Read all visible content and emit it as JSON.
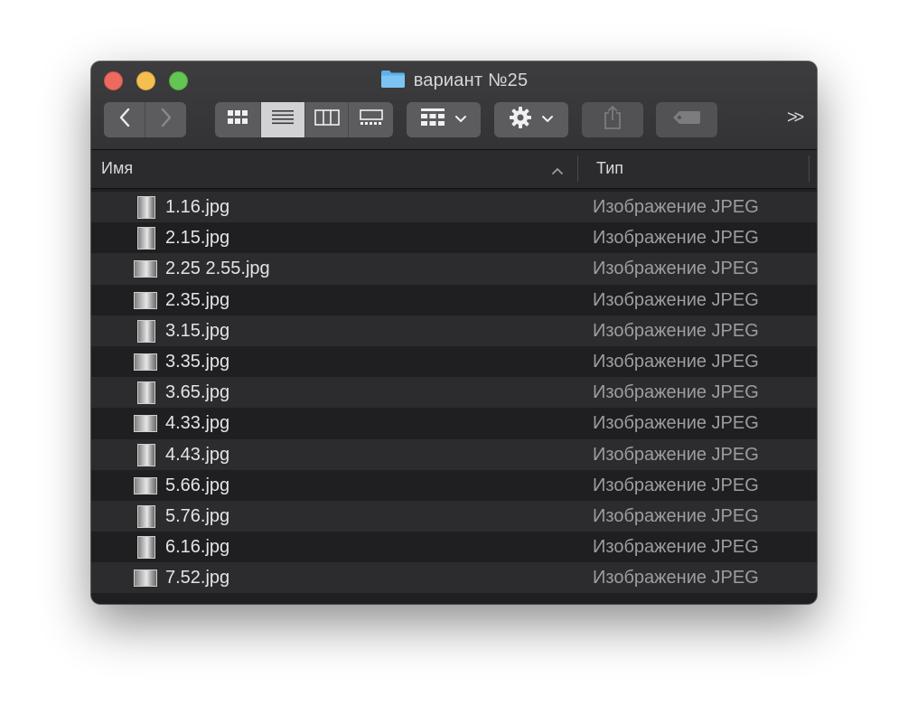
{
  "window": {
    "title": "вариант №25",
    "title_icon": "folder-icon"
  },
  "toolbar": {
    "back_icon": "chevron-left-icon",
    "forward_icon": "chevron-right-icon",
    "view_modes": [
      {
        "name": "icon-view",
        "icon": "grid-icon",
        "active": false
      },
      {
        "name": "list-view",
        "icon": "list-icon",
        "active": true
      },
      {
        "name": "column-view",
        "icon": "columns-icon",
        "active": false
      },
      {
        "name": "gallery-view",
        "icon": "gallery-icon",
        "active": false
      }
    ],
    "group_icon": "group-by-icon",
    "action_icon": "gear-icon",
    "share_icon": "share-icon",
    "tags_icon": "tag-icon",
    "overflow_label": ">>"
  },
  "list": {
    "columns": {
      "name": "Имя",
      "type": "Тип"
    },
    "rows": [
      {
        "name": "1.16.jpg",
        "type": "Изображение JPEG",
        "orientation": "portrait"
      },
      {
        "name": "2.15.jpg",
        "type": "Изображение JPEG",
        "orientation": "portrait"
      },
      {
        "name": "2.25 2.55.jpg",
        "type": "Изображение JPEG",
        "orientation": "landscape"
      },
      {
        "name": "2.35.jpg",
        "type": "Изображение JPEG",
        "orientation": "landscape"
      },
      {
        "name": "3.15.jpg",
        "type": "Изображение JPEG",
        "orientation": "portrait"
      },
      {
        "name": "3.35.jpg",
        "type": "Изображение JPEG",
        "orientation": "landscape"
      },
      {
        "name": "3.65.jpg",
        "type": "Изображение JPEG",
        "orientation": "portrait"
      },
      {
        "name": "4.33.jpg",
        "type": "Изображение JPEG",
        "orientation": "landscape"
      },
      {
        "name": "4.43.jpg",
        "type": "Изображение JPEG",
        "orientation": "portrait"
      },
      {
        "name": "5.66.jpg",
        "type": "Изображение JPEG",
        "orientation": "landscape"
      },
      {
        "name": "5.76.jpg",
        "type": "Изображение JPEG",
        "orientation": "portrait"
      },
      {
        "name": "6.16.jpg",
        "type": "Изображение JPEG",
        "orientation": "portrait"
      },
      {
        "name": "7.52.jpg",
        "type": "Изображение JPEG",
        "orientation": "landscape"
      }
    ]
  },
  "colors": {
    "close": "#ed6a5e",
    "minimize": "#f5bf4f",
    "zoom": "#62c554",
    "folder": "#5fb0e8"
  }
}
